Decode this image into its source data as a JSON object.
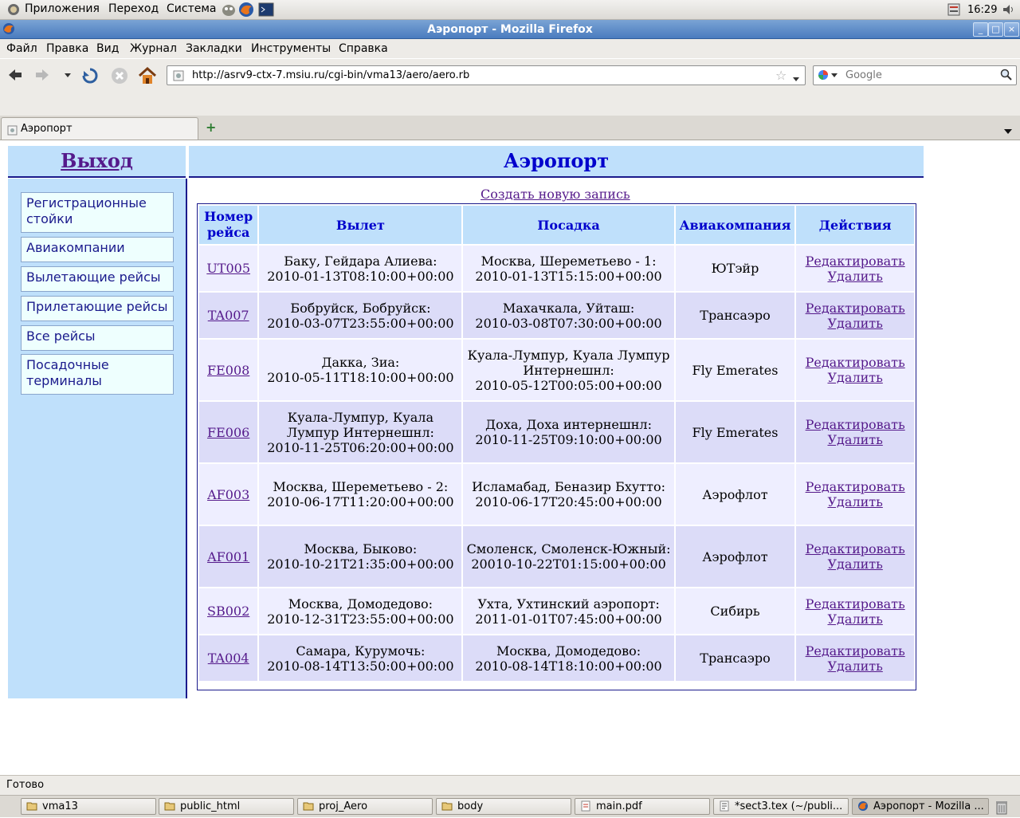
{
  "panel": {
    "menus": [
      "Приложения",
      "Переход",
      "Система"
    ],
    "clock": "16:29"
  },
  "window": {
    "title": "Аэропорт - Mozilla Firefox",
    "buttons": [
      "_",
      "□",
      "×"
    ]
  },
  "menubar": [
    "Файл",
    "Правка",
    "Вид",
    "Журнал",
    "Закладки",
    "Инструменты",
    "Справка"
  ],
  "navbar": {
    "url": "http://asrv9-ctx-7.msiu.ru/cgi-bin/vma13/aero/aero.rb",
    "search_placeholder": "Google"
  },
  "tabs": [
    {
      "label": "Аэропорт"
    }
  ],
  "page": {
    "logout": "Выход",
    "title": "Аэропорт",
    "create_link": "Создать новую запись",
    "sidebar": [
      "Регистрационные стойки",
      "Авиакомпании",
      "Вылетающие рейсы",
      "Прилетающие рейсы",
      "Все рейсы",
      "Посадочные терминалы"
    ],
    "table": {
      "headers": [
        "Номер рейса",
        "Вылет",
        "Посадка",
        "Авиакомпания",
        "Действия"
      ],
      "edit_label": "Редактировать",
      "delete_label": "Удалить",
      "rows": [
        {
          "flight": "UT005",
          "dep_place": "Баку, Гейдара Алиева:",
          "dep_time": "2010-01-13T08:10:00+00:00",
          "arr_place": "Москва, Шереметьево - 1:",
          "arr_time": "2010-01-13T15:15:00+00:00",
          "airline": "ЮТэйр"
        },
        {
          "flight": "TA007",
          "dep_place": "Бобруйск, Бобруйск:",
          "dep_time": "2010-03-07T23:55:00+00:00",
          "arr_place": "Махачкала, Уйташ:",
          "arr_time": "2010-03-08T07:30:00+00:00",
          "airline": "Трансаэро"
        },
        {
          "flight": "FE008",
          "dep_place": "Дакка, Зиа:",
          "dep_time": "2010-05-11T18:10:00+00:00",
          "arr_place": "Куала-Лумпур, Куала Лумпур Интернешнл:",
          "arr_time": "2010-05-12T00:05:00+00:00",
          "airline": "Fly Emerates"
        },
        {
          "flight": "FE006",
          "dep_place": "Куала-Лумпур, Куала Лумпур Интернешнл:",
          "dep_time": "2010-11-25T06:20:00+00:00",
          "arr_place": "Доха, Доха интернешнл:",
          "arr_time": "2010-11-25T09:10:00+00:00",
          "airline": "Fly Emerates"
        },
        {
          "flight": "AF003",
          "dep_place": "Москва, Шереметьево - 2:",
          "dep_time": "2010-06-17T11:20:00+00:00",
          "arr_place": "Исламабад, Беназир Бхутто:",
          "arr_time": "2010-06-17T20:45:00+00:00",
          "airline": "Аэрофлот"
        },
        {
          "flight": "AF001",
          "dep_place": "Москва, Быково:",
          "dep_time": "2010-10-21T21:35:00+00:00",
          "arr_place": "Смоленск, Смоленск-Южный:",
          "arr_time": "20010-10-22T01:15:00+00:00",
          "airline": "Аэрофлот"
        },
        {
          "flight": "SB002",
          "dep_place": "Москва, Домодедово:",
          "dep_time": "2010-12-31T23:55:00+00:00",
          "arr_place": "Ухта, Ухтинский аэропорт:",
          "arr_time": "2011-01-01T07:45:00+00:00",
          "airline": "Сибирь"
        },
        {
          "flight": "TA004",
          "dep_place": "Самара, Курумочь:",
          "dep_time": "2010-08-14T13:50:00+00:00",
          "arr_place": "Москва, Домодедово:",
          "arr_time": "2010-08-14T18:10:00+00:00",
          "airline": "Трансаэро"
        }
      ]
    }
  },
  "status": "Готово",
  "taskbar": [
    "vma13",
    "public_html",
    "proj_Aero",
    "body",
    "main.pdf",
    "*sect3.tex (~/publi...",
    "Аэропорт - Mozilla ..."
  ],
  "colors": {
    "header_bg": "#bfe0fb",
    "link_visited": "#551a8b",
    "title_blue": "#0000cc",
    "row_odd": "#eeeeff",
    "row_even": "#dcdcf8"
  }
}
